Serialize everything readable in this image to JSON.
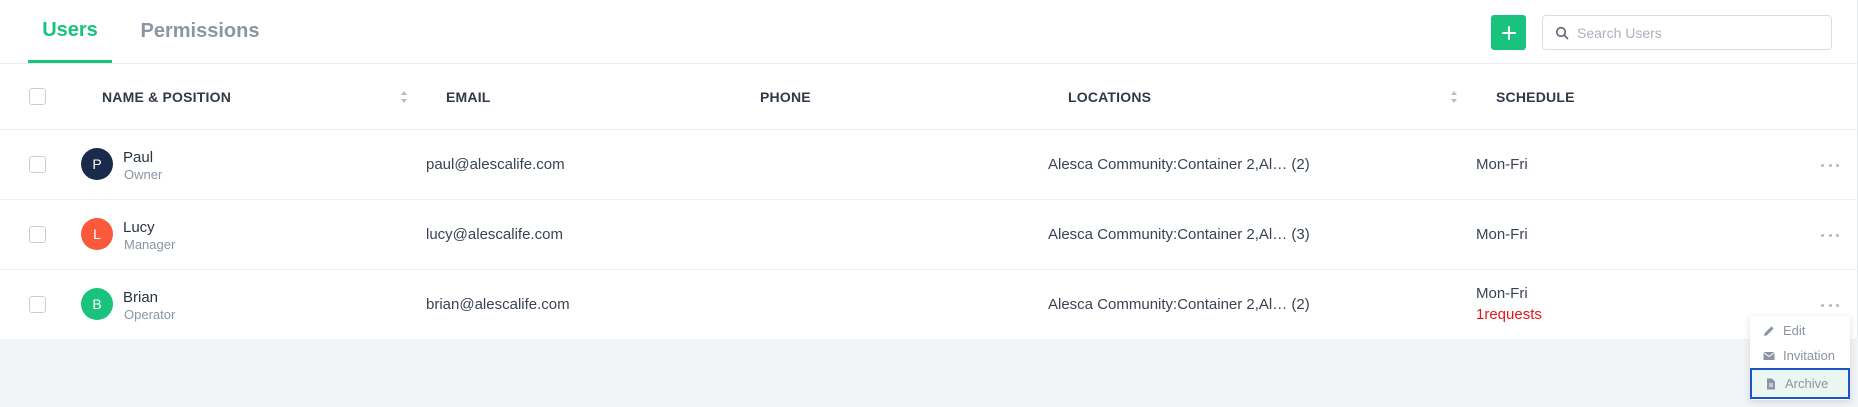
{
  "tabs": [
    {
      "label": "Users",
      "active": true
    },
    {
      "label": "Permissions",
      "active": false
    }
  ],
  "search": {
    "placeholder": "Search Users",
    "value": ""
  },
  "table": {
    "columns": [
      "NAME & POSITION",
      "EMAIL",
      "PHONE",
      "LOCATIONS",
      "SCHEDULE"
    ],
    "rows": [
      {
        "initial": "P",
        "avatar_color": "#1b2a4a",
        "name": "Paul",
        "role": "Owner",
        "email": "paul@alescalife.com",
        "phone": "",
        "locations": "Alesca Community:Container 2,Al… (2)",
        "schedule": "Mon-Fri",
        "requests": ""
      },
      {
        "initial": "L",
        "avatar_color": "#fa5a3a",
        "name": "Lucy",
        "role": "Manager",
        "email": "lucy@alescalife.com",
        "phone": "",
        "locations": "Alesca Community:Container 2,Al… (3)",
        "schedule": "Mon-Fri",
        "requests": ""
      },
      {
        "initial": "B",
        "avatar_color": "#19c37d",
        "name": "Brian",
        "role": "Operator",
        "email": "brian@alescalife.com",
        "phone": "",
        "locations": "Alesca Community:Container 2,Al… (2)",
        "schedule": "Mon-Fri",
        "requests": "1requests"
      }
    ]
  },
  "menu": {
    "items": [
      {
        "label": "Edit",
        "icon": "pencil-icon"
      },
      {
        "label": "Invitation",
        "icon": "envelope-icon"
      },
      {
        "label": "Archive",
        "icon": "document-icon",
        "highlighted": true
      }
    ]
  },
  "colors": {
    "accent": "#19c37d",
    "request_text": "#e3161e",
    "highlight_border": "#1c55c7"
  }
}
